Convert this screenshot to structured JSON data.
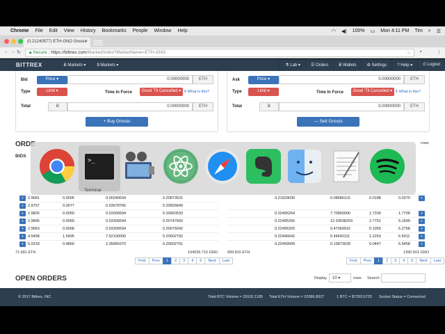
{
  "menubar": {
    "app": "Chrome",
    "items": [
      "File",
      "Edit",
      "View",
      "History",
      "Bookmarks",
      "People",
      "Window",
      "Help"
    ],
    "battery": "100%",
    "clock": "Mon 4:11 PM",
    "user": "Tim"
  },
  "browser": {
    "tab_title": "(0.21240577) ETH-GNO Gnosis",
    "secure_label": "Secure",
    "url_host": "https://bittrex.com",
    "url_path": "/Market/Index?MarketName=ETH-GNO"
  },
  "site_nav": {
    "brand": "BITTREX",
    "left": [
      "Ƀ Markets ▾",
      "$ Markets ▾"
    ],
    "right": [
      "⚗ Lab ▾",
      "☰ Orders",
      "Ƀ Wallets",
      "⚙ Settings",
      "? Help ▾",
      "⏻ Logout"
    ]
  },
  "buy_form": {
    "bid_label": "Bid",
    "price_button": "Price ▾",
    "bid_value": "0.00000000",
    "bid_unit": "ETH",
    "type_label": "Type",
    "type_button": "Limit ▾",
    "tif_label": "Time In Force",
    "tif_button": "Good 'Til Cancelled ▾",
    "what_link": "¢ What is this?",
    "total_label": "Total",
    "total_prefix": "Ƀ",
    "total_value": "0.00000000",
    "total_unit": "ETH",
    "submit": "+ Buy Gnosis"
  },
  "sell_form": {
    "ask_label": "Ask",
    "price_button": "Price ▾",
    "ask_value": "0.00000000",
    "ask_unit": "ETH",
    "type_label": "Type",
    "type_button": "Limit ▾",
    "tif_label": "Time In Force",
    "tif_button": "Good 'Til Cancelled ▾",
    "what_link": "¢ What is this?",
    "total_label": "Total",
    "total_prefix": "Ƀ",
    "total_value": "0.00000000",
    "total_unit": "ETH",
    "submit": "— Sell Gnosis"
  },
  "order_book": {
    "title": "ORDE",
    "bids_label": "BIDS",
    "rows_label": "rows",
    "bids": [
      [
        "2.9681",
        "0.0005",
        "0.00240634",
        "0.20873531"
      ],
      [
        "2.9757",
        "0.0077",
        "0.03678766",
        "0.20826849"
      ],
      [
        "2.9826",
        "0.0069",
        "0.03306594",
        "0.20820533"
      ],
      [
        "2.9895",
        "0.0069",
        "0.03306594",
        "0.20747660"
      ],
      [
        "2.9963",
        "0.0068",
        "0.03306594",
        "0.20675042"
      ],
      [
        "4.5458",
        "1.5495",
        "7.52100000",
        "0.20602792"
      ],
      [
        "5.0318",
        "0.4860",
        "2.35890370",
        "0.20602791"
      ]
    ],
    "asks": [
      [
        "0.21629030",
        "0.08680115",
        "0.0188",
        "0.0370"
      ],
      [
        "0.22495264",
        "7.70800000",
        "1.7339",
        "1.7709"
      ],
      [
        "0.22495266",
        "12.33638203",
        "2.7751",
        "5.1699"
      ],
      [
        "0.22495320",
        "0.47069916",
        "0.1059",
        "5.2758"
      ],
      [
        "0.22496642",
        "5.44642111",
        "1.2253",
        "6.5011"
      ],
      [
        "0.22499999",
        "0.19873539",
        "0.0447",
        "6.5458"
      ]
    ],
    "bids_total_left": "71.681 ETH",
    "bids_total_right": "194939.710 GNO",
    "asks_total_left": "999.816 ETH",
    "asks_total_right": "1390.501 GNO",
    "pager": [
      "First",
      "Prev",
      "1",
      "2",
      "3",
      "4",
      "5",
      "Next",
      "Last"
    ]
  },
  "open_orders": {
    "title": "OPEN ORDERS",
    "display_label": "Display",
    "display_value": "10 ▾",
    "rows_label": "rows",
    "search_label": "Search:"
  },
  "dock": {
    "tooltip": "Terminal",
    "apps": [
      "chrome-icon",
      "terminal-icon",
      "photo-slideshow-icon",
      "atom-icon",
      "safari-icon",
      "evernote-icon",
      "finder-icon",
      "textedit-icon",
      "spotify-icon"
    ]
  },
  "footer": {
    "copyright": "© 2017 Bittrex, INC",
    "btc_volume": "Total BTC Volume = 29102.1185",
    "eth_volume": "Total ETH Volume = 20386.8927",
    "btc_rate": "1 BTC = $7293.5725",
    "socket": "Socket Status = Connected"
  },
  "colors": {
    "nav_bg": "#2c3e50",
    "primary": "#3a73b8",
    "danger": "#d9534f"
  }
}
